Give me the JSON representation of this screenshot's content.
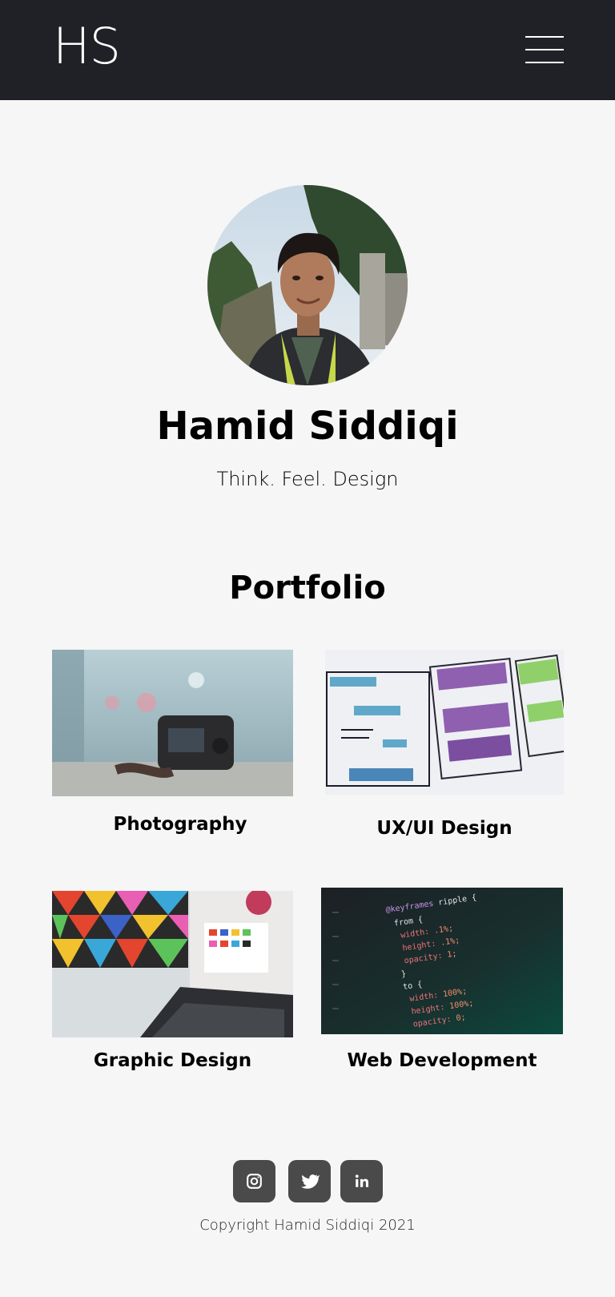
{
  "header": {
    "logo": "HS",
    "menu_icon": "hamburger-menu-icon"
  },
  "profile": {
    "name": "Hamid Siddiqi",
    "tagline": "Think. Feel. Design"
  },
  "portfolio": {
    "title": "Portfolio",
    "items": [
      {
        "label": "Photography"
      },
      {
        "label": "UX/UI Design"
      },
      {
        "label": "Graphic Design"
      },
      {
        "label": "Web Development"
      }
    ]
  },
  "footer": {
    "social": [
      {
        "icon": "instagram-icon"
      },
      {
        "icon": "twitter-icon"
      },
      {
        "icon": "linkedin-icon"
      }
    ],
    "copyright": "Copyright Hamid Siddiqi  2021"
  },
  "colors": {
    "header_bg": "#1f2126",
    "page_bg": "#f6f6f6",
    "social_bg": "#4a4a4b"
  }
}
